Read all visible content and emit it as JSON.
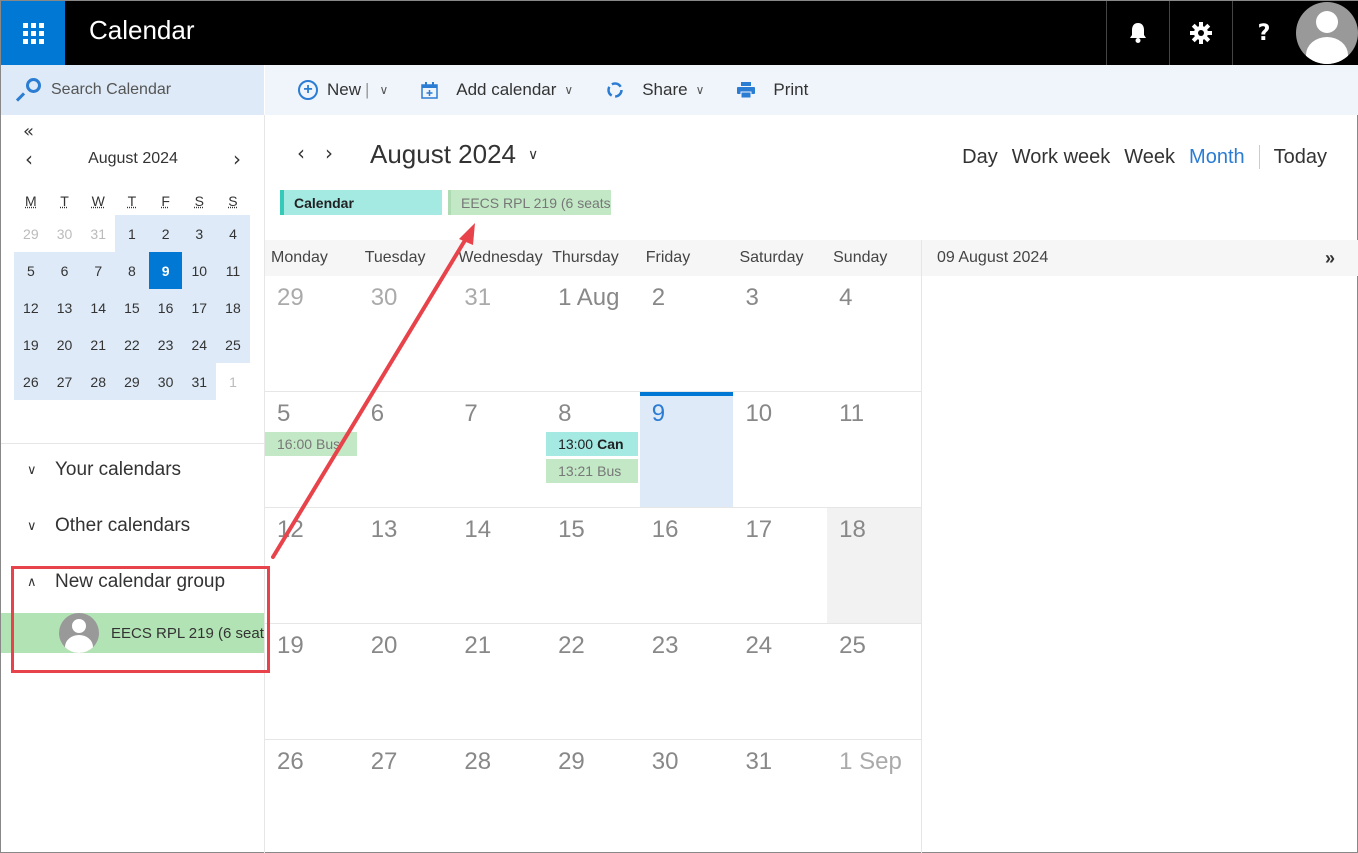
{
  "app": {
    "title": "Calendar",
    "top_icons": [
      "bell-icon",
      "gear-icon",
      "help-icon"
    ],
    "help_glyph": "?"
  },
  "search": {
    "placeholder": "Search Calendar"
  },
  "toolbar": {
    "new_label": "New",
    "add_calendar_label": "Add calendar",
    "share_label": "Share",
    "print_label": "Print"
  },
  "mini_calendar": {
    "title": "August 2024",
    "weekdays": [
      "M",
      "T",
      "W",
      "T",
      "F",
      "S",
      "S"
    ],
    "weeks": [
      [
        "29",
        "30",
        "31",
        "1",
        "2",
        "3",
        "4"
      ],
      [
        "5",
        "6",
        "7",
        "8",
        "9",
        "10",
        "11"
      ],
      [
        "12",
        "13",
        "14",
        "15",
        "16",
        "17",
        "18"
      ],
      [
        "19",
        "20",
        "21",
        "22",
        "23",
        "24",
        "25"
      ],
      [
        "26",
        "27",
        "28",
        "29",
        "30",
        "31",
        "1"
      ]
    ],
    "selected_day": "9"
  },
  "calendar_groups": [
    {
      "label": "Your calendars",
      "expanded": false
    },
    {
      "label": "Other calendars",
      "expanded": false
    },
    {
      "label": "New calendar group",
      "expanded": true
    }
  ],
  "group_calendar_item": {
    "label": "EECS RPL 219 (6 seat"
  },
  "main": {
    "month_title": "August 2024",
    "views": {
      "day": "Day",
      "work_week": "Work week",
      "week": "Week",
      "month": "Month",
      "today": "Today"
    },
    "active_view": "Month",
    "calendar_chips": [
      {
        "label": "Calendar",
        "color": "#a5e9e3"
      },
      {
        "label": "EECS RPL 219 (6 seats",
        "color": "#c3e8c6"
      }
    ],
    "weekday_headers": [
      "Monday",
      "Tuesday",
      "Wednesday",
      "Thursday",
      "Friday",
      "Saturday",
      "Sunday"
    ],
    "weeks": [
      [
        "29",
        "30",
        "31",
        "1 Aug",
        "2",
        "3",
        "4"
      ],
      [
        "5",
        "6",
        "7",
        "8",
        "9",
        "10",
        "11"
      ],
      [
        "12",
        "13",
        "14",
        "15",
        "16",
        "17",
        "18"
      ],
      [
        "19",
        "20",
        "21",
        "22",
        "23",
        "24",
        "25"
      ],
      [
        "26",
        "27",
        "28",
        "29",
        "30",
        "31",
        "1 Sep"
      ]
    ],
    "events": {
      "aug5": [
        {
          "time": "16:00",
          "title": "Bus",
          "type": "busy"
        }
      ],
      "aug8": [
        {
          "time": "13:00",
          "title": "Can",
          "type": "calendar"
        },
        {
          "time": "13:21",
          "title": "Bus",
          "type": "busy"
        }
      ]
    }
  },
  "right_pane": {
    "date": "09 August 2024"
  },
  "colors": {
    "accent": "#0078d4",
    "link": "#2b7cd3",
    "selected_bg": "#deeaf7",
    "calendar_event": "#a5e9e3",
    "busy_event": "#c3e8c6",
    "annotation": "#e8434a"
  }
}
